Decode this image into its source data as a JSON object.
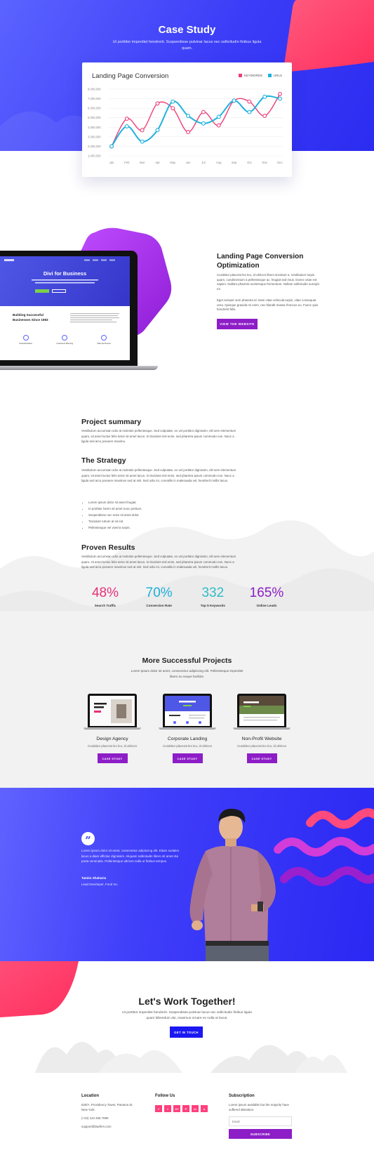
{
  "hero": {
    "title": "Case Study",
    "subtitle": "Ut porttitor imperdiet hendrerit. Suspendisse pulvinar lacus nec sollicitudin finibus ligula quam."
  },
  "chart_data": {
    "type": "line",
    "title": "Landing Page Conversion",
    "categories": [
      "Jan",
      "Feb",
      "Mar",
      "Apr",
      "May",
      "Jun",
      "Jul",
      "Aug",
      "Sep",
      "Oct",
      "Nov",
      "Dec"
    ],
    "y_ticks": [
      "1,000,000",
      "2,000,000",
      "3,000,000",
      "4,000,000",
      "5,000,000",
      "6,000,000",
      "7,000,000",
      "8,000,000"
    ],
    "ylim": [
      1000000,
      8000000
    ],
    "legend_position": "top-right",
    "grid": true,
    "series": [
      {
        "name": "KEYWORDS",
        "color": "#ee3d78",
        "values": [
          2000000,
          4900000,
          3700000,
          6500000,
          6000000,
          3500000,
          5600000,
          4200000,
          6800000,
          6700000,
          5200000,
          7500000
        ]
      },
      {
        "name": "URLS",
        "color": "#1fb1dd",
        "values": [
          2000000,
          4100000,
          2500000,
          3700000,
          6700000,
          5200000,
          4400000,
          5100000,
          6800000,
          5600000,
          7200000,
          7000000
        ]
      }
    ]
  },
  "intro": {
    "title": "Landing Page Conversion Optimization",
    "p1": "Curabitur placerat leo leo, id ultrices libero tincidunt a. Vestibulum turpis quam, condimentum a pellentesque ac, feugiat sed risus. Donec vitae est sapien. Nullam pharetra scelerisque fermentum. Nullam sollicitudin suscipit mi.",
    "p2": "Eget semper sem pharetra id. Nam vitae vehicula turpis, vitae consequat urna. Quisque gravida mi enim, nec blandit massa rhoncus eu. Fusce quis hendrerit felis.",
    "button": "VIEW THE WEBSITE",
    "laptop": {
      "title": "Divi for Business",
      "heading_line1": "Building Successful",
      "heading_line2": "Businesses Since 1983",
      "icon1": "Financial Advice",
      "icon2": "Investment Planning",
      "icon3": "Safe and Secure"
    }
  },
  "summary": {
    "title": "Project summary",
    "text": "Vestibulum accumsan odio at molestie pellentesque. Sed vulputate, ex vel porttitor dignissim, elit sem elementum quam, sit amet luctus felis tortor sit amet lacus. In tincidunt nisl enim, sed pharetra ipsum commodo non. Nunc a ligula sed arcu posuere maximu."
  },
  "strategy": {
    "title": "The Strategy",
    "text": "Vestibulum accumsan odio at molestie pellentesque. Sed vulputate, ex vel porttitor dignissim, elit sem elementum quam, sit amet luctus felis tortor sit amet lacus. In tincidunt nisl enim, sed pharetra ipsum commodo non. Nunc a ligula sed arcu posuere maximus sed at nisl. Sed odio mi, convallis in malesuada vel, hendrerit mollis lacus.",
    "bullets": [
      "Lorem ipsum dolor sit amet feugiat.",
      "In porttitor lorem sit amet nunc pretium.",
      "Suspendisse nec enim sit amet dolor.",
      "Tincidunt rutrum at sit est.",
      "Pellentesque vel viverra turpis."
    ]
  },
  "results": {
    "title": "Proven Results",
    "text": "Vestibulum accumsan odio at molestie pellentesque. Sed vulputate, ex vel porttitor dignissim, elit sem elementum quam, sit amet luctus felis tortor sit amet lacus. In tincidunt nisl enim, sed pharetra ipsum commodo non. Nunc a ligula sed arcu posuere maximus sed at nisl. Sed odio mi, convallis in malesuada vel, hendrerit mollis lacus.",
    "stats": [
      {
        "value": "48%",
        "label": "Search Traffic",
        "color": "#e8307a"
      },
      {
        "value": "70%",
        "label": "Conversion Rate",
        "color": "#1db0d9"
      },
      {
        "value": "332",
        "label": "Top 5 Keywords",
        "color": "#2fbcc6"
      },
      {
        "value": "165%",
        "label": "Online Leads",
        "color": "#8d1ec7"
      }
    ]
  },
  "more": {
    "title": "More Successful Projects",
    "subtitle": "Lorem ipsum dolor sit amet, consectetur adipiscing elit. Pellentesque imperdiet libero eu neque facilisis.",
    "cards": [
      {
        "title": "Design Agency",
        "desc": "Curabitur placerat leo leo, id ultrices",
        "button": "CASE STUDY"
      },
      {
        "title": "Corporate Landing",
        "desc": "Curabitur placerat leo leo, id ultrices",
        "button": "CASE STUDY"
      },
      {
        "title": "Non-Profit Website",
        "desc": "Curabitur placerat leo leo, id ultrices",
        "button": "CASE STUDY"
      }
    ]
  },
  "testimonial": {
    "quote_mark": "”",
    "text": "Lorem ipsum dolor sit amet, consectetur adipiscing elit. Etiam sodales lacus a diam efficitur dignissim. Aliquam sollicitudin libero sit amet dui porta venenatis. Pellentesque ultrices nulla ut finibus tempus.",
    "name": "Tamim Shaharia",
    "role": "Lead Developer, Food Inc."
  },
  "cta": {
    "title": "Let's Work Together!",
    "subtitle": "Ut porttitor imperdiet hendrerit. Suspendisse pulvinar lacus nec sollicitudin finibus ligula quam bibendum dui, maximus ornare ex nulla ut lacus.",
    "button": "GET IN TOUCH"
  },
  "footer": {
    "location_title": "Location",
    "address1": "625/A, Providency Tower, Panama St,",
    "address2": "New York.",
    "phone": "(+22) 123 456 7890",
    "email": "support@lawfirm.com",
    "follow_title": "Follow Us",
    "socials": [
      "f",
      "t",
      "G+",
      "P",
      "in",
      "o"
    ],
    "subscription_title": "Subscription",
    "subscription_text": "Lorem ipsum available but the majority have suffered alteration.",
    "email_placeholder": "Email",
    "subscribe_button": "SUBSCRIBE"
  }
}
